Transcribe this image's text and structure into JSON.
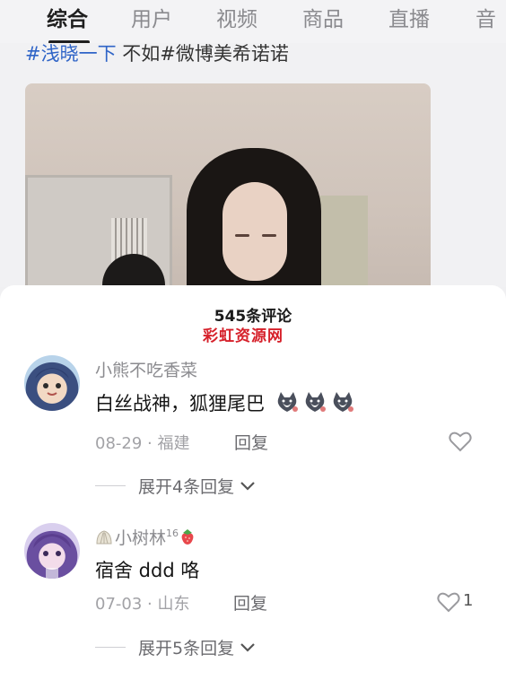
{
  "tabs": [
    "综合",
    "用户",
    "视频",
    "商品",
    "直播",
    "音"
  ],
  "active_tab": 0,
  "post": {
    "hashtag_text": "#浅晓一下",
    "hashtag_rest": "不如#微博美希诺诺"
  },
  "sheet": {
    "title": "545条评论",
    "watermark": "彩虹资源网"
  },
  "comments": [
    {
      "username": "小熊不吃香菜",
      "text": "白丝战神，狐狸尾巴",
      "emoji_count": 3,
      "date": "08-29",
      "location": "福建",
      "reply_label": "回复",
      "likes": "",
      "expand_label": "展开4条回复"
    },
    {
      "username": "小树林",
      "level": "16",
      "text": "宿舍 ddd 咯",
      "date": "07-03",
      "location": "山东",
      "reply_label": "回复",
      "likes": "1",
      "expand_label": "展开5条回复"
    }
  ],
  "separator": "·",
  "colors": {
    "accent_text": "#1f1f1f",
    "hashtag": "#2f64c7",
    "watermark": "#d6202a",
    "muted": "#8b8b8f"
  }
}
